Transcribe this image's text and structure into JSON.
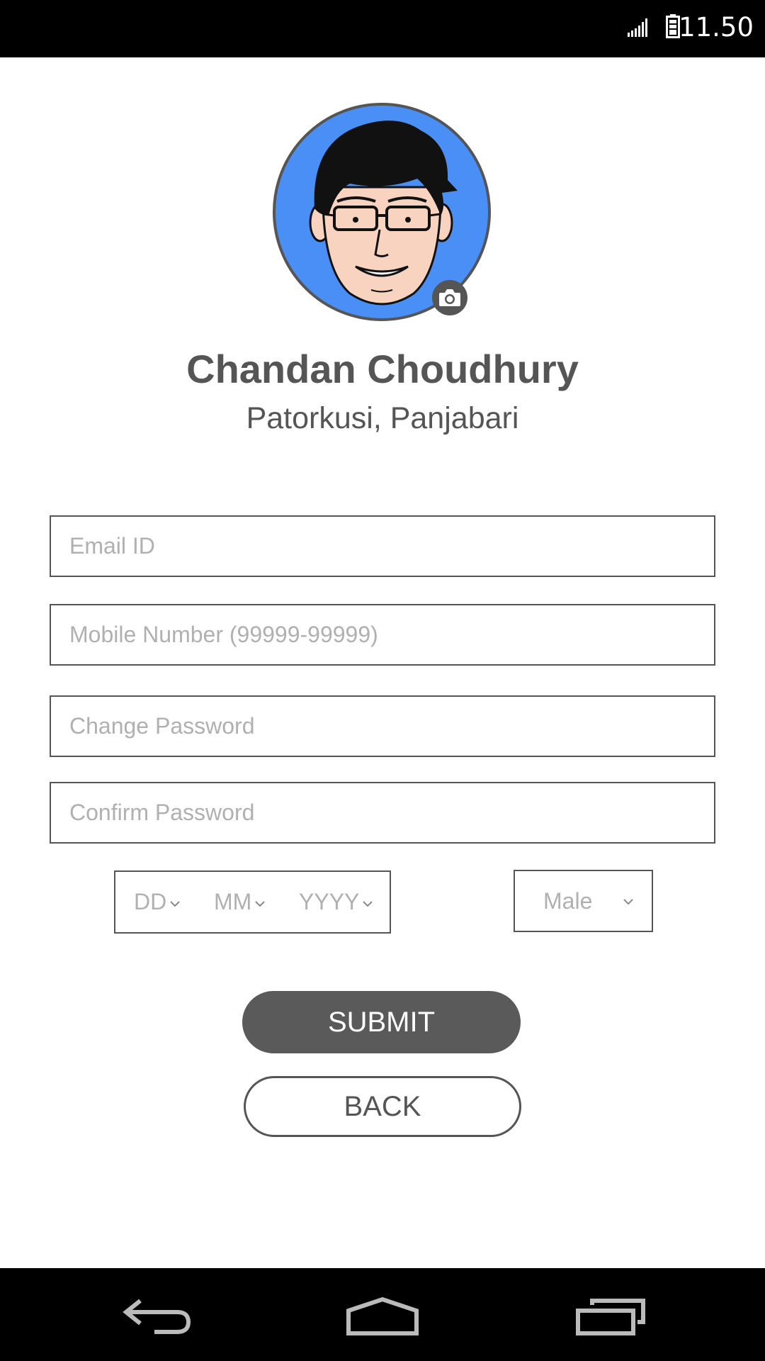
{
  "status_bar": {
    "time": "11.50",
    "icons": [
      "signal-icon",
      "battery-icon"
    ]
  },
  "profile": {
    "name": "Chandan Choudhury",
    "location": "Patorkusi, Panjabari",
    "avatar": "cartoon-avatar-man-with-glasses",
    "avatar_background": "#4a8ff5",
    "camera_icon": "camera-icon"
  },
  "form": {
    "email_placeholder": "Email ID",
    "mobile_placeholder": "Mobile Number (99999-99999)",
    "password_placeholder": "Change Password",
    "confirm_placeholder": "Confirm Password",
    "dob": {
      "day": "DD",
      "month": "MM",
      "year": "YYYY"
    },
    "gender": "Male"
  },
  "buttons": {
    "submit_label": "SUBMIT",
    "back_label": "BACK"
  },
  "nav_bar": {
    "icons": [
      "back-icon",
      "home-icon",
      "recents-icon"
    ]
  },
  "colors": {
    "primary": "#5a5a5a",
    "text": "#555555",
    "placeholder": "#b0b0b0",
    "bars": "#000000"
  }
}
